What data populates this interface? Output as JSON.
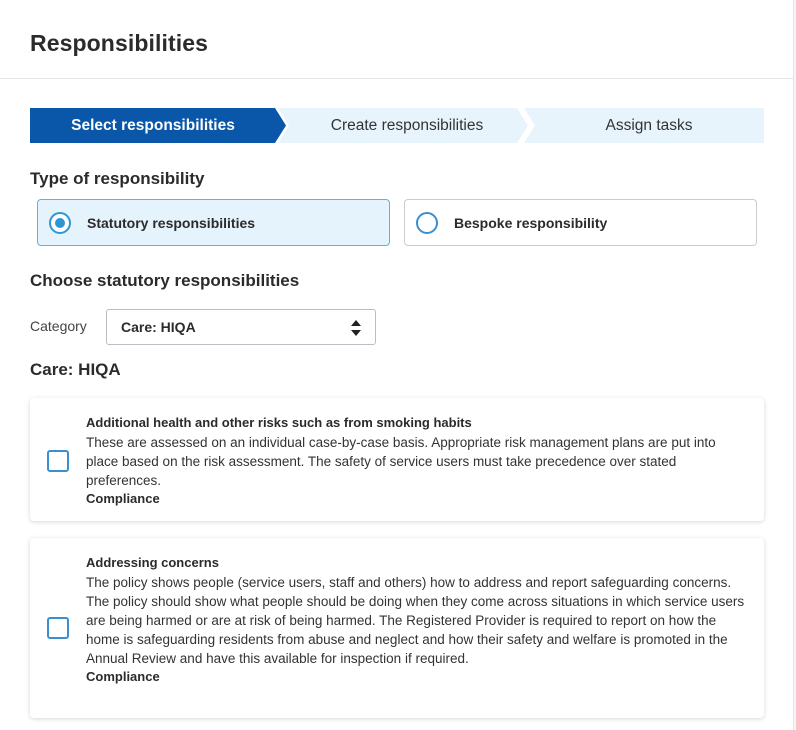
{
  "header": {
    "title": "Responsibilities"
  },
  "stepper": {
    "steps": [
      {
        "label": "Select responsibilities",
        "active": true
      },
      {
        "label": "Create responsibilities",
        "active": false
      },
      {
        "label": "Assign tasks",
        "active": false
      }
    ]
  },
  "type_section": {
    "heading": "Type of responsibility",
    "options": [
      {
        "label": "Statutory responsibilities",
        "selected": true
      },
      {
        "label": "Bespoke responsibility",
        "selected": false
      }
    ]
  },
  "choose_section": {
    "heading": "Choose statutory responsibilities",
    "category_label": "Category",
    "category_value": "Care: HIQA"
  },
  "list_heading": "Care: HIQA",
  "responsibilities": [
    {
      "title": "Additional health and other risks such as from smoking habits",
      "description": "These are assessed on an individual case-by-case basis. Appropriate risk management plans are put into place based on the risk assessment. The safety of service users must take precedence over stated preferences.",
      "tag": "Compliance",
      "checked": false
    },
    {
      "title": "Addressing concerns",
      "description": "The policy shows people (service users, staff and others) how to address and report safeguarding concerns. The policy should show what people should be doing when they come across situations in which service users are being harmed or are at risk of being harmed. The Registered Provider is required to report on how the home is safeguarding residents from abuse and neglect and how their safety and welfare is promoted in the Annual Review and have this available for inspection if required.",
      "tag": "Compliance",
      "checked": false
    }
  ],
  "colors": {
    "active_step": "#0a56a8",
    "inactive_step": "#e8f4fc",
    "accent": "#2f95d6",
    "selected_option_bg": "#e4f3fc"
  }
}
